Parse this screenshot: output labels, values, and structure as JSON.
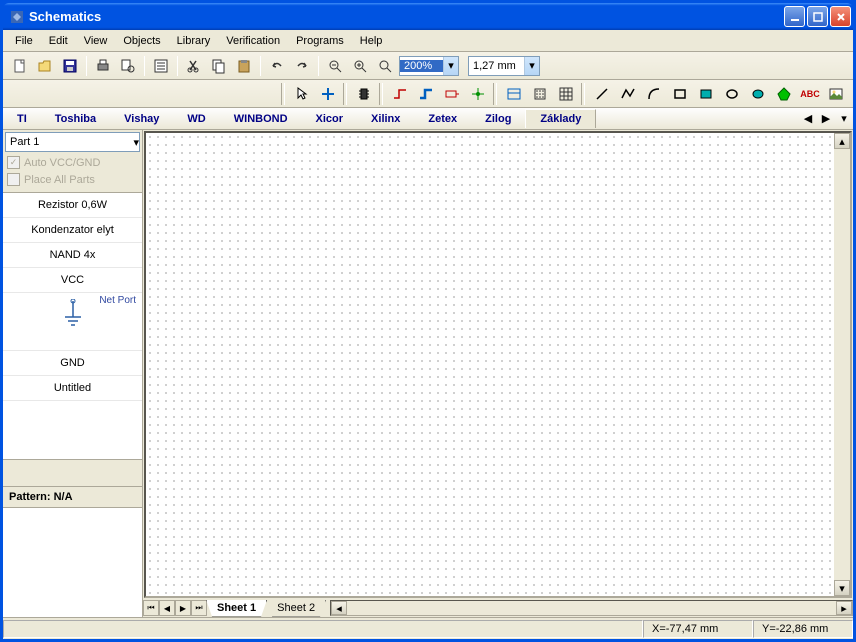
{
  "window": {
    "title": "Schematics"
  },
  "menu": {
    "items": [
      "File",
      "Edit",
      "View",
      "Objects",
      "Library",
      "Verification",
      "Programs",
      "Help"
    ]
  },
  "toolbar": {
    "zoom_value": "200%",
    "grid_value": "1,27 mm"
  },
  "makers": {
    "items": [
      "TI",
      "Toshiba",
      "Vishay",
      "WD",
      "WINBOND",
      "Xicor",
      "Xilinx",
      "Zetex",
      "Zilog",
      "Základy"
    ],
    "active_index": 9
  },
  "sidebar": {
    "part_selector": "Part 1",
    "auto_vcc_label": "Auto VCC/GND",
    "place_all_label": "Place All Parts",
    "parts": [
      "Rezistor 0,6W",
      "Kondenzator elyt",
      "NAND 4x",
      "VCC"
    ],
    "netport_label": "Net Port",
    "gnd_label": "GND",
    "untitled_label": "Untitled",
    "pattern_label": "Pattern: N/A"
  },
  "sheets": {
    "tabs": [
      "Sheet 1",
      "Sheet 2"
    ],
    "active_index": 0
  },
  "status": {
    "x": "X=-77,47 mm",
    "y": "Y=-22,86 mm"
  }
}
